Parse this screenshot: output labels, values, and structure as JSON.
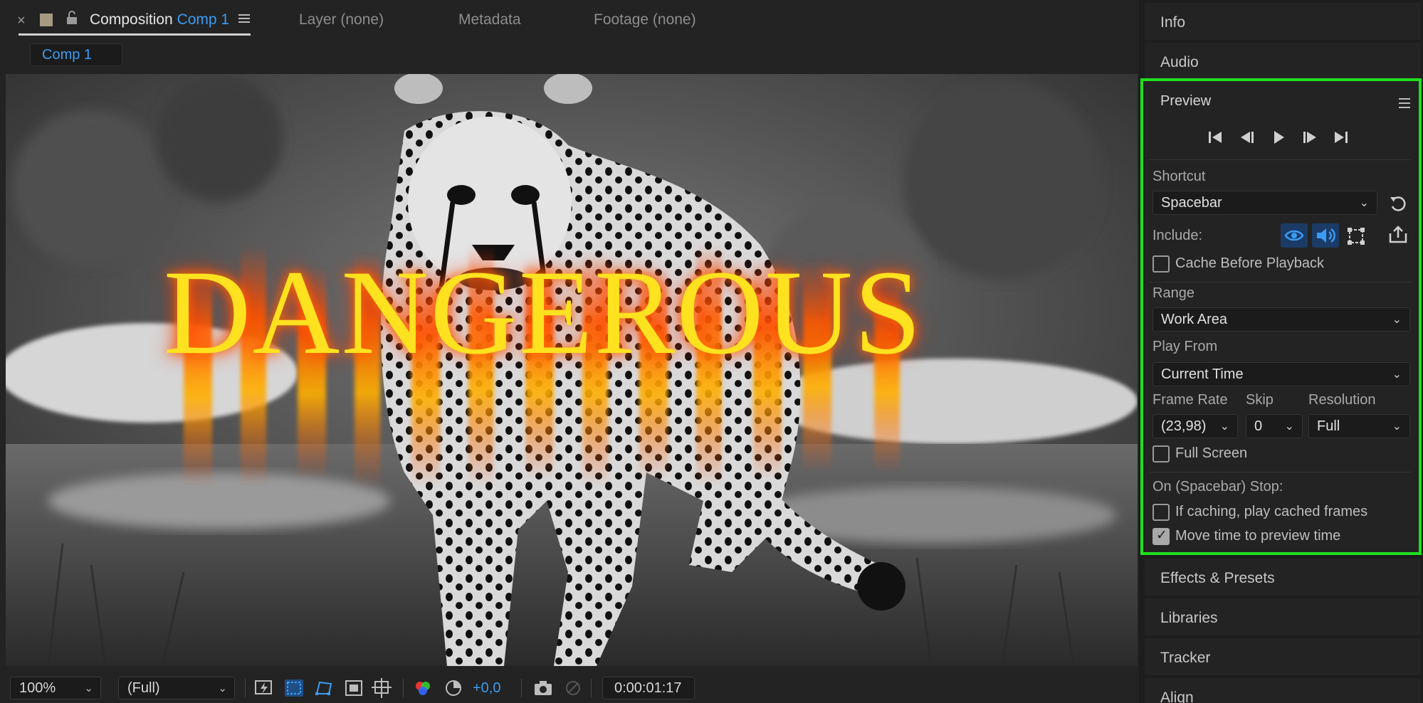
{
  "composition_panel": {
    "tabs": [
      {
        "label": "Composition",
        "accent": "Comp 1"
      },
      {
        "label": "Layer (none)"
      },
      {
        "label": "Metadata"
      },
      {
        "label": "Footage (none)"
      }
    ],
    "breadcrumb": "Comp 1",
    "overlay_text": "DANGEROUS",
    "bottom_bar": {
      "zoom": "100%",
      "resolution": "(Full)",
      "exposure": "+0,0",
      "timecode": "0:00:01:17"
    }
  },
  "right_panels": {
    "collapsed_top": [
      "Info",
      "Audio"
    ],
    "preview": {
      "title": "Preview",
      "shortcut_label": "Shortcut",
      "shortcut_value": "Spacebar",
      "include_label": "Include:",
      "cache_before_playback": {
        "label": "Cache Before Playback",
        "checked": false
      },
      "range_label": "Range",
      "range_value": "Work Area",
      "play_from_label": "Play From",
      "play_from_value": "Current Time",
      "frame_rate_label": "Frame Rate",
      "frame_rate_value": "(23,98)",
      "skip_label": "Skip",
      "skip_value": "0",
      "resolution_label": "Resolution",
      "resolution_value": "Full",
      "full_screen": {
        "label": "Full Screen",
        "checked": false
      },
      "on_stop_label": "On (Spacebar) Stop:",
      "if_caching": {
        "label": "If caching, play cached frames",
        "checked": false
      },
      "move_time": {
        "label": "Move time to preview time",
        "checked": true
      }
    },
    "collapsed_bottom": [
      "Effects & Presets",
      "Libraries",
      "Tracker",
      "Align"
    ]
  },
  "colors": {
    "accent_blue": "#3b9cf3",
    "highlight_green": "#1fe01f",
    "panel_bg": "#232323",
    "text_yellow": "#ffe21f",
    "fire_orange": "#ff5a00"
  }
}
